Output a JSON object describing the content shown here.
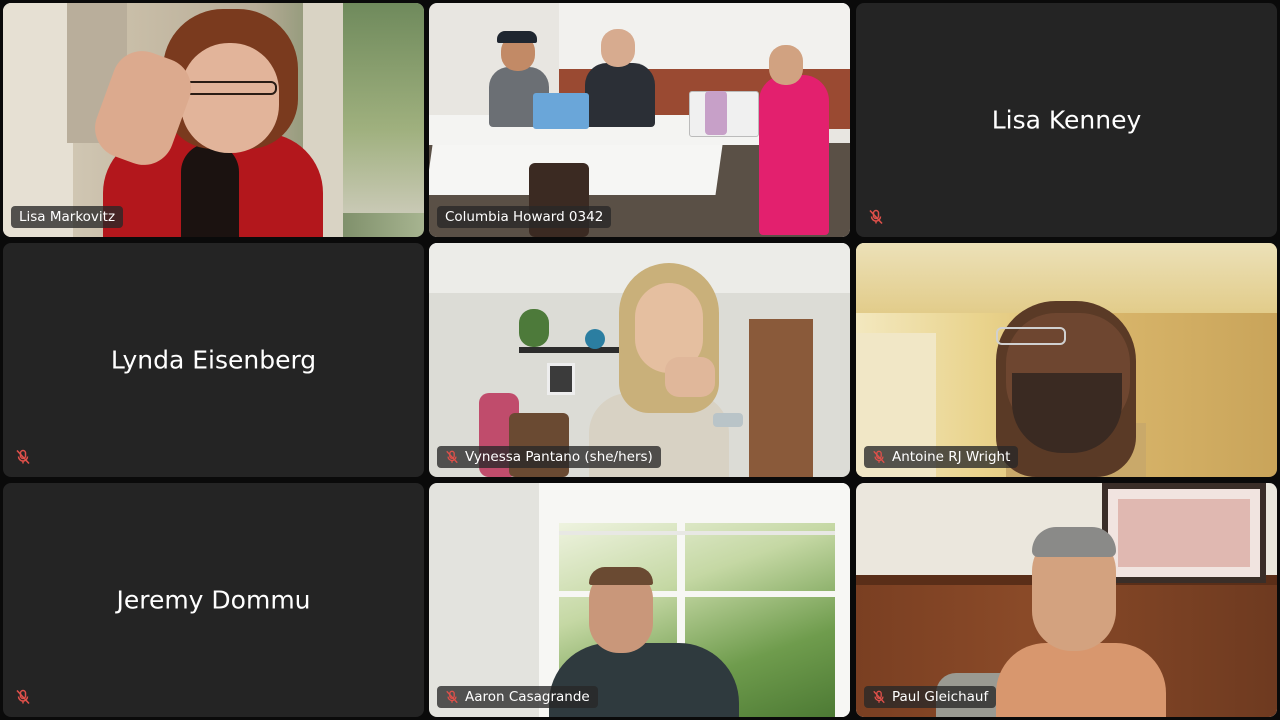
{
  "participants": [
    {
      "name": "Lisa Markovitz",
      "muted": false,
      "video": true
    },
    {
      "name": "Columbia Howard 0342",
      "muted": false,
      "video": true
    },
    {
      "name": "Lisa Kenney",
      "muted": true,
      "video": false
    },
    {
      "name": "Lynda Eisenberg",
      "muted": true,
      "video": false
    },
    {
      "name": "Vynessa Pantano (she/hers)",
      "muted": true,
      "video": true
    },
    {
      "name": "Antoine RJ Wright",
      "muted": true,
      "video": true
    },
    {
      "name": "Jeremy Dommu",
      "muted": true,
      "video": false
    },
    {
      "name": "Aaron Casagrande",
      "muted": true,
      "video": true
    },
    {
      "name": "Paul Gleichauf",
      "muted": true,
      "video": true
    }
  ],
  "icons": {
    "muted_mic": "muted-mic-icon"
  },
  "colors": {
    "tile_bg": "#242424",
    "tag_bg": "rgba(40,40,40,0.78)",
    "mute_red": "#e0504a",
    "text": "#ffffff"
  }
}
